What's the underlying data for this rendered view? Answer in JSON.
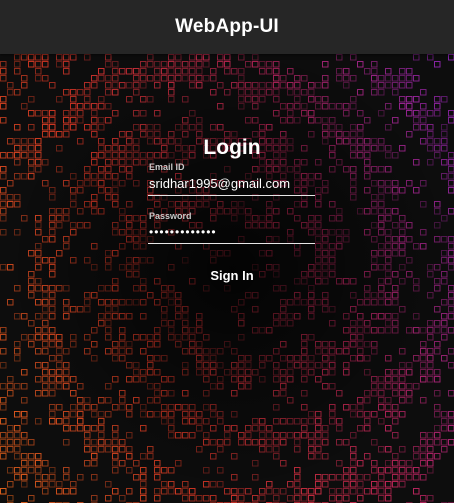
{
  "app": {
    "title": "WebApp-UI"
  },
  "login": {
    "title": "Login",
    "email": {
      "label": "Email ID",
      "value": "sridhar1995@gmail.com"
    },
    "password": {
      "label": "Password",
      "value": "•••••••••••••"
    },
    "sign_in_label": "Sign In"
  },
  "theme": {
    "topbar_color": "#262626",
    "background_color": "#0d0d0d",
    "accent_colors": [
      "#ff6a1a",
      "#ff2f2f",
      "#d82a6a",
      "#9b2cc9"
    ]
  }
}
